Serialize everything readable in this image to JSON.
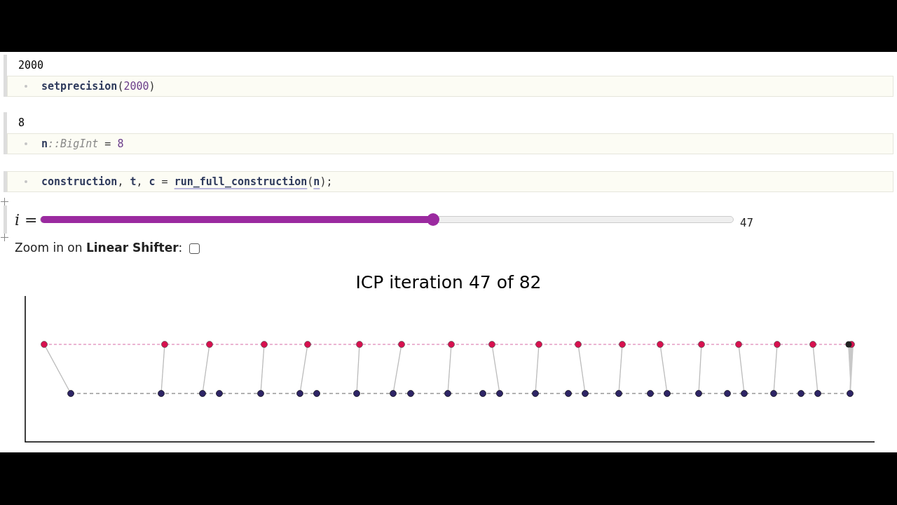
{
  "cells": [
    {
      "output": "2000",
      "code": [
        {
          "text": "setprecision",
          "kind": "ident"
        },
        {
          "text": "(",
          "kind": "punct"
        },
        {
          "text": "2000",
          "kind": "number"
        },
        {
          "text": ")",
          "kind": "punct"
        }
      ]
    },
    {
      "output": "8",
      "code": [
        {
          "text": "n",
          "kind": "ident"
        },
        {
          "text": "::BigInt",
          "kind": "type"
        },
        {
          "text": " = ",
          "kind": "punct"
        },
        {
          "text": "8",
          "kind": "number"
        }
      ]
    },
    {
      "code": [
        {
          "text": "construction",
          "kind": "ident"
        },
        {
          "text": ", ",
          "kind": "punct"
        },
        {
          "text": "t",
          "kind": "ident"
        },
        {
          "text": ", ",
          "kind": "punct"
        },
        {
          "text": "c",
          "kind": "ident"
        },
        {
          "text": " = ",
          "kind": "punct"
        },
        {
          "text": "run_full_construction",
          "kind": "link"
        },
        {
          "text": "(",
          "kind": "punct"
        },
        {
          "text": "n",
          "kind": "link"
        },
        {
          "text": ");",
          "kind": "punct"
        }
      ]
    }
  ],
  "slider": {
    "label": "*i* =",
    "level": 0.567,
    "reading": "47"
  },
  "checkbox": {
    "text": "Zoom in on **Linear Shifter**:",
    "checked": false
  },
  "chart": {
    "title": "ICP iteration 47 of 82"
  }
}
